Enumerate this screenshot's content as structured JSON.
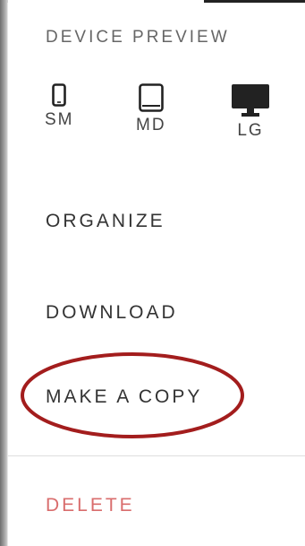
{
  "menu": {
    "device_preview_title": "DEVICE PREVIEW",
    "devices": [
      {
        "label": "SM",
        "icon": "phone-icon"
      },
      {
        "label": "MD",
        "icon": "tablet-icon"
      },
      {
        "label": "LG",
        "icon": "desktop-monitor-icon"
      }
    ],
    "items": {
      "organize": "ORGANIZE",
      "download": "DOWNLOAD",
      "make_copy": "MAKE A COPY",
      "delete": "DELETE"
    }
  },
  "colors": {
    "text": "#333333",
    "muted": "#666666",
    "danger": "#d96d6d",
    "highlight_ring": "#a31d1d"
  }
}
